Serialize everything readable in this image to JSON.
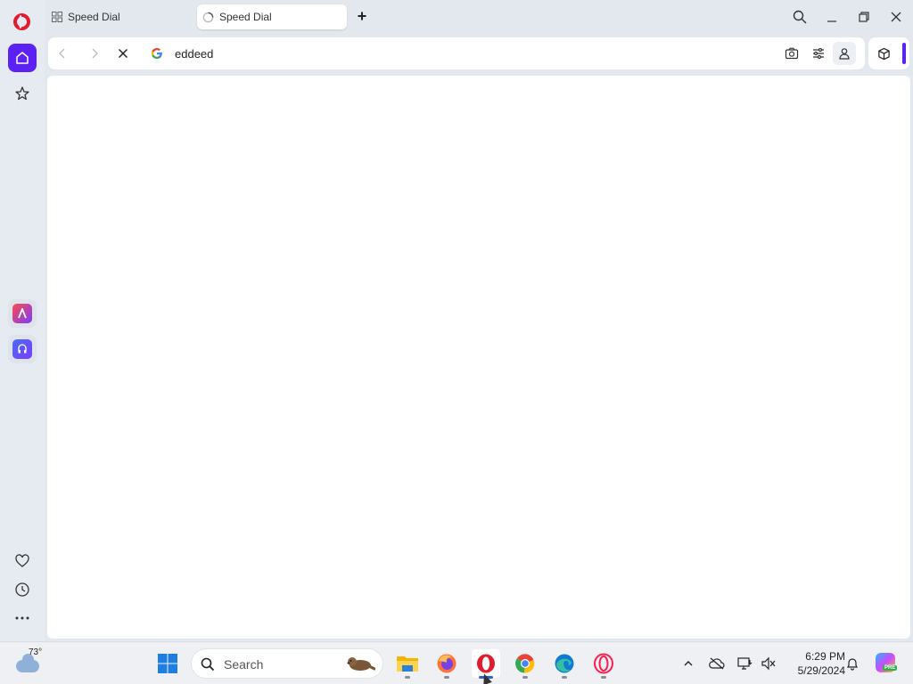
{
  "browser": {
    "tabs": [
      {
        "label": "Speed Dial",
        "active": false
      },
      {
        "label": "Speed Dial",
        "active": true,
        "loading": true
      }
    ],
    "address_bar": {
      "value": "eddeed",
      "search_engine_icon": "google-g-icon"
    },
    "accent_color": "#5b21f5"
  },
  "sidebar": {
    "items": [
      {
        "name": "home",
        "icon": "home-icon",
        "active": true
      },
      {
        "name": "bookmarks",
        "icon": "star-icon"
      },
      {
        "name": "aria",
        "icon": "aria-app-icon"
      },
      {
        "name": "music-player",
        "icon": "music-app-icon"
      },
      {
        "name": "pinboards",
        "icon": "heart-icon"
      },
      {
        "name": "history",
        "icon": "clock-icon"
      },
      {
        "name": "more",
        "icon": "more-icon"
      }
    ]
  },
  "taskbar": {
    "weather_temp": "73°",
    "search_label": "Search",
    "apps": [
      "file-explorer",
      "firefox",
      "opera",
      "chrome",
      "edge",
      "opera-gx"
    ],
    "clock": {
      "time": "6:29 PM",
      "date": "5/29/2024"
    },
    "copilot_badge": "PRE"
  }
}
